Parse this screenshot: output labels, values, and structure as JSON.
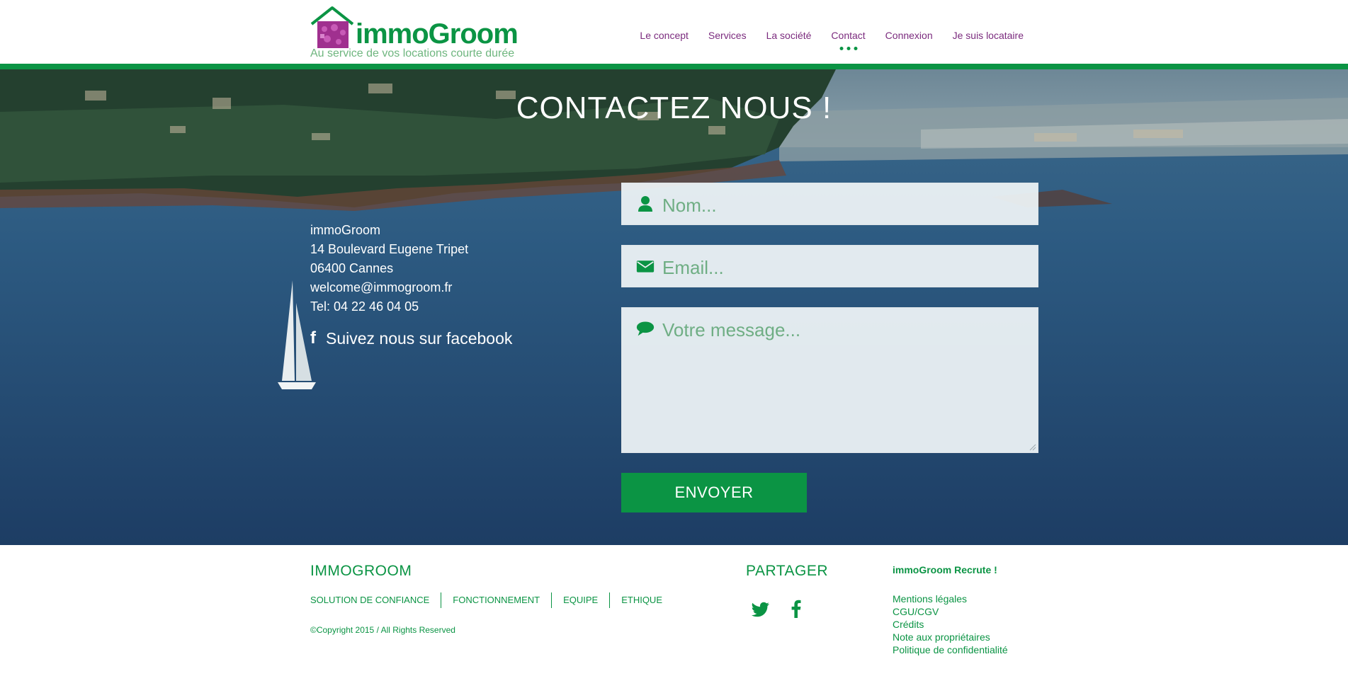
{
  "brand": {
    "name": "immoGroom",
    "tagline": "Au service de vos locations courte durée",
    "green": "#0b9444",
    "purple": "#7b2b7e"
  },
  "nav": {
    "items": [
      {
        "label": "Le concept",
        "active": false
      },
      {
        "label": "Services",
        "active": false
      },
      {
        "label": "La société",
        "active": false
      },
      {
        "label": "Contact",
        "active": true
      },
      {
        "label": "Connexion",
        "active": false
      },
      {
        "label": "Je suis locataire",
        "active": false
      }
    ]
  },
  "hero": {
    "title": "CONTACTEZ NOUS !"
  },
  "contact": {
    "company": "immoGroom",
    "street": "14 Boulevard Eugene Tripet",
    "city": "06400 Cannes",
    "email": "welcome@immogroom.fr",
    "phone": "Tel: 04 22 46 04 05",
    "facebook_label": "Suivez nous sur facebook",
    "facebook_glyph": "f"
  },
  "form": {
    "name_placeholder": "Nom...",
    "email_placeholder": "Email...",
    "message_placeholder": "Votre message...",
    "submit_label": "ENVOYER",
    "icons": {
      "name": "user-icon",
      "email": "envelope-icon",
      "message": "comment-icon"
    }
  },
  "footer": {
    "title": "IMMOGROOM",
    "links": [
      "SOLUTION DE CONFIANCE",
      "FONCTIONNEMENT",
      "EQUIPE",
      "ETHIQUE"
    ],
    "copyright": "©Copyright 2015 / All Rights Reserved",
    "share_title": "PARTAGER",
    "social": [
      "twitter-icon",
      "facebook-icon"
    ],
    "recrute": "immoGroom Recrute !",
    "legal": [
      "Mentions légales",
      "CGU/CGV",
      "Crédits",
      "Note aux propriétaires",
      "Politique de confidentialité"
    ]
  }
}
